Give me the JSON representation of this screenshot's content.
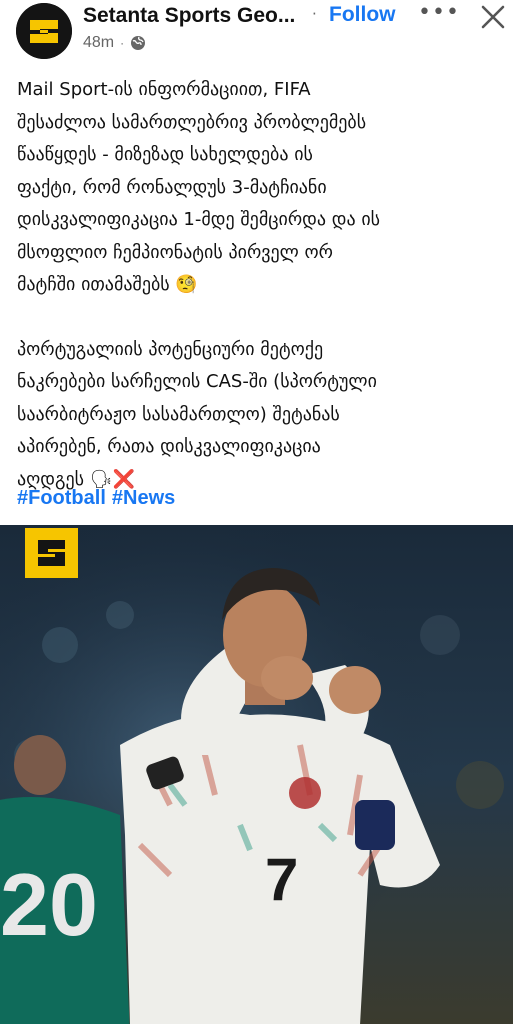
{
  "header": {
    "page_name": "Setanta Sports Geo...",
    "separator": "·",
    "follow_label": "Follow",
    "more_label": "•••",
    "time": "48m",
    "meta_separator": "·"
  },
  "post": {
    "paragraph1": [
      "Mail Sport-ის ინფორმაციით, FIFA",
      "შესაძლოა სამართლებრივ პრობლემებს",
      "წააწყდეს - მიზეზად სახელდება ის",
      "ფაქტი, რომ რონალდუს 3-მატჩიანი",
      "დისკვალიფიკაცია 1-მდე შემცირდა და ის",
      "მსოფლიო ჩემპიონატის პირველ ორ",
      "მატჩში ითამაშებს 🧐"
    ],
    "paragraph2": [
      "პორტუგალიის პოტენციური მეტოქე",
      "ნაკრებები სარჩელის CAS-ში (სპორტული",
      "საარბიტრაჟო სასამართლო) შეტანას",
      "აპირებენ, რათა დისკვალიფიკაცია",
      "აღდგეს 🗣❌"
    ],
    "hashtags": [
      "#Football",
      "#News"
    ]
  },
  "image": {
    "player_number": "7",
    "background_number": "20",
    "icons": [
      "setanta-logo-icon",
      "globe-icon",
      "close-icon",
      "more-icon"
    ]
  },
  "colors": {
    "accent": "#1877f2",
    "brand_yellow": "#f6c500",
    "text": "#111111",
    "muted": "#666666"
  }
}
